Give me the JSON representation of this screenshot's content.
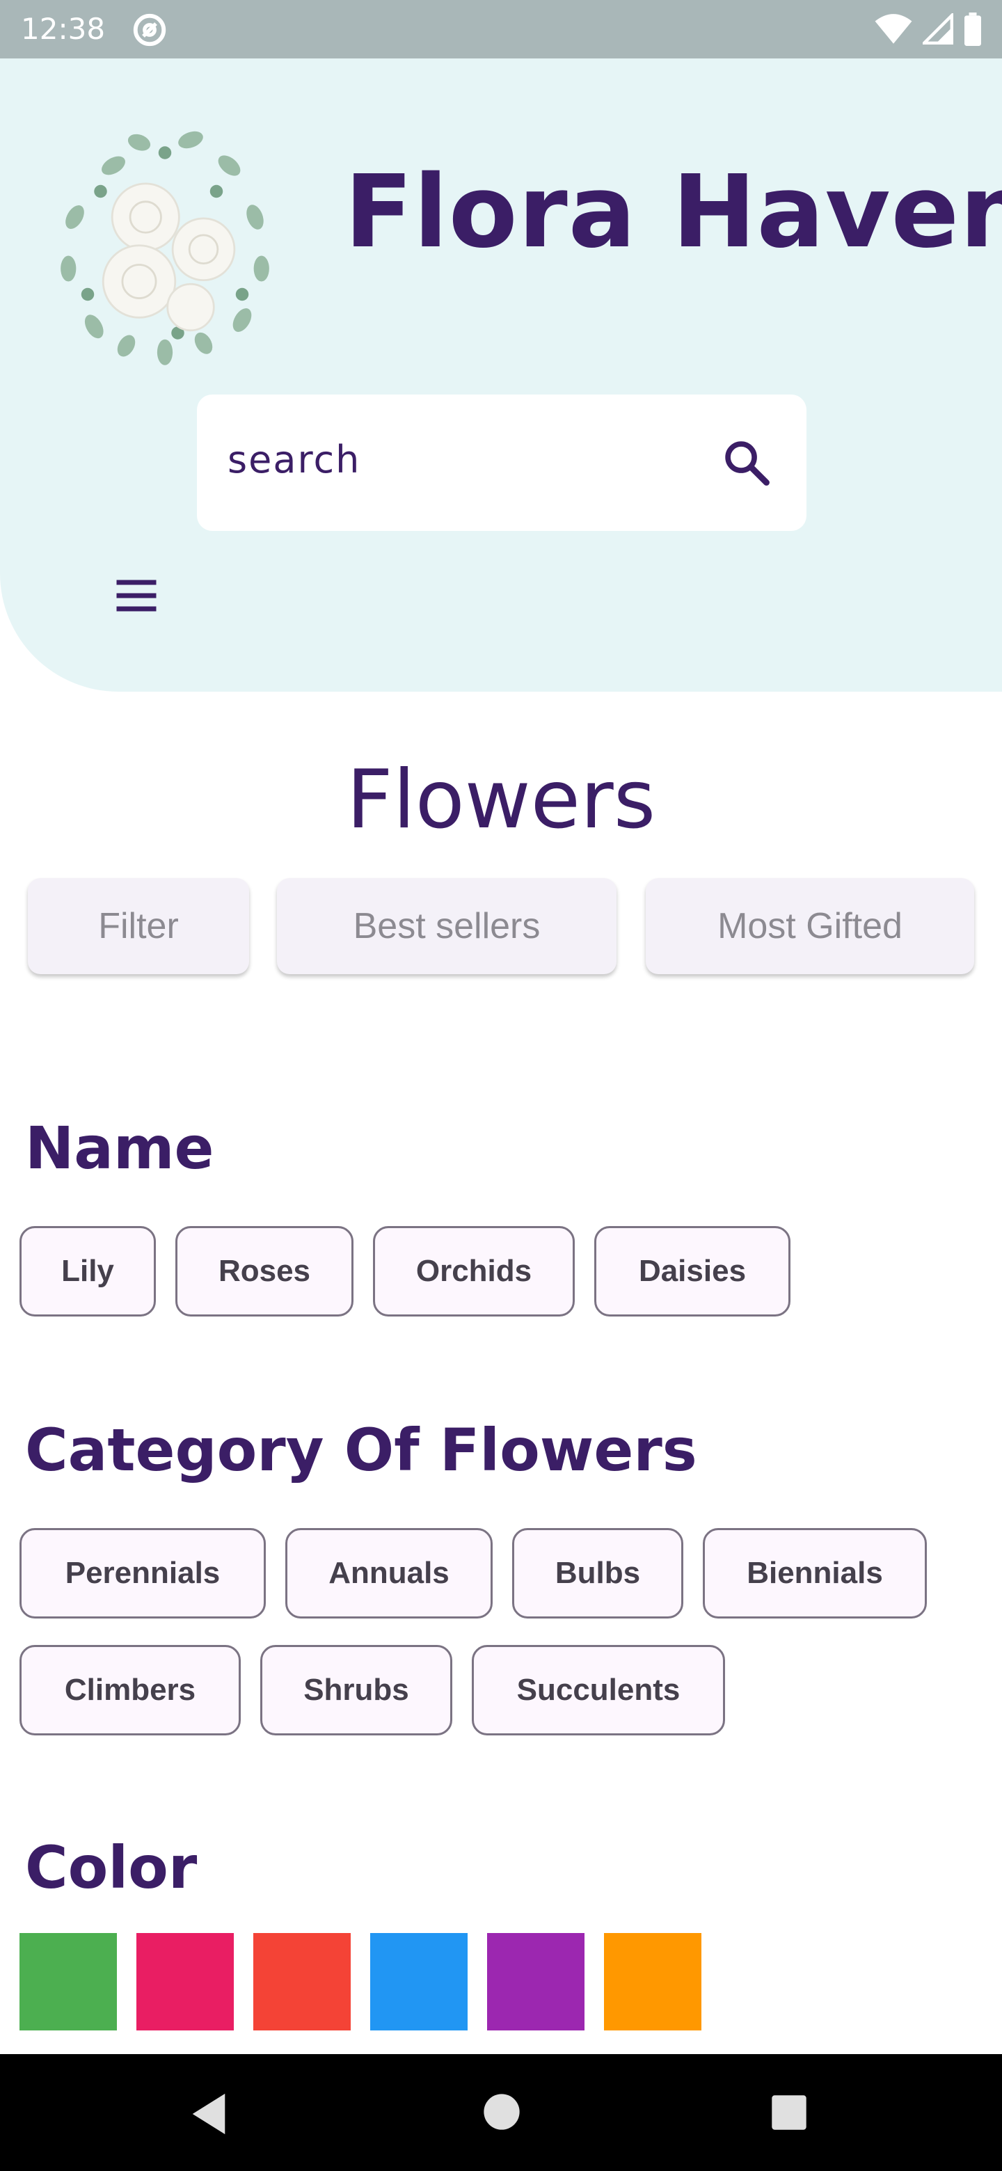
{
  "status_bar": {
    "time": "12:38"
  },
  "header": {
    "brand": "Flora Haven",
    "search_placeholder": "search"
  },
  "section": {
    "title": "Flowers"
  },
  "tabs": [
    {
      "label": "Filter"
    },
    {
      "label": "Best sellers"
    },
    {
      "label": "Most Gifted"
    }
  ],
  "name_group": {
    "title": "Name",
    "chips": [
      {
        "label": "Lily"
      },
      {
        "label": "Roses"
      },
      {
        "label": "Orchids"
      },
      {
        "label": "Daisies"
      }
    ]
  },
  "category_group": {
    "title": "Category Of Flowers",
    "chips": [
      {
        "label": "Perennials"
      },
      {
        "label": "Annuals"
      },
      {
        "label": "Bulbs"
      },
      {
        "label": "Biennials"
      },
      {
        "label": "Climbers"
      },
      {
        "label": "Shrubs"
      },
      {
        "label": "Succulents"
      }
    ]
  },
  "color_group": {
    "title": "Color",
    "swatches": [
      {
        "color": "#4caf50"
      },
      {
        "color": "#e91e63"
      },
      {
        "color": "#f44336"
      },
      {
        "color": "#2196f3"
      },
      {
        "color": "#9c27b0"
      },
      {
        "color": "#ff9800"
      }
    ]
  },
  "theme": {
    "accent": "#3b1e66",
    "hero_bg": "#e6f5f6"
  }
}
